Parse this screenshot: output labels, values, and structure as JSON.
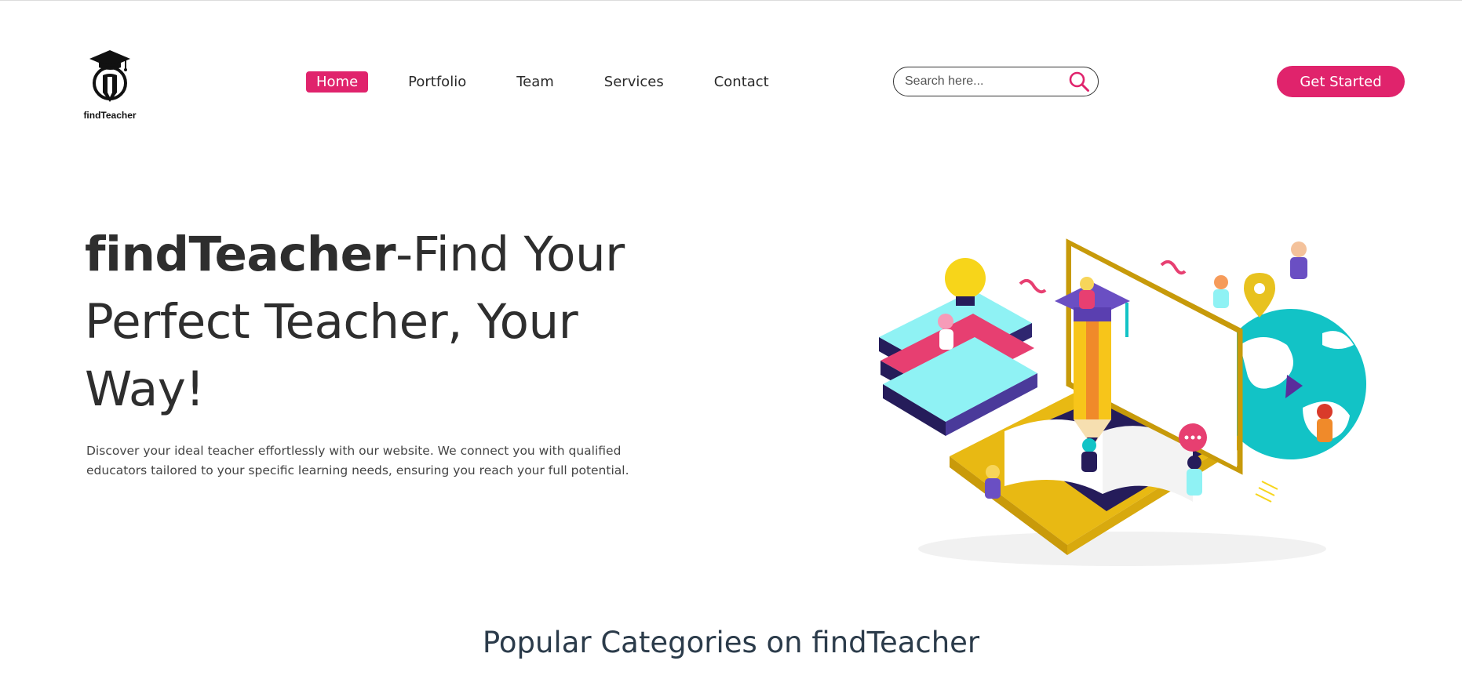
{
  "brand": {
    "name": "findTeacher",
    "accent_color": "#e0236c"
  },
  "nav": {
    "items": [
      {
        "label": "Home",
        "active": true
      },
      {
        "label": "Portfolio",
        "active": false
      },
      {
        "label": "Team",
        "active": false
      },
      {
        "label": "Services",
        "active": false
      },
      {
        "label": "Contact",
        "active": false
      }
    ]
  },
  "search": {
    "placeholder": "Search here...",
    "icon": "search-icon"
  },
  "header": {
    "cta_label": "Get Started"
  },
  "hero": {
    "title_brand": "findTeacher",
    "title_rest": "-Find Your Perfect Teacher, Your Way!",
    "description": "Discover your ideal teacher effortlessly with our website. We connect you with qualified educators tailored to your specific learning needs, ensuring you reach your full potential."
  },
  "categories": {
    "title": "Popular Categories on findTeacher"
  }
}
